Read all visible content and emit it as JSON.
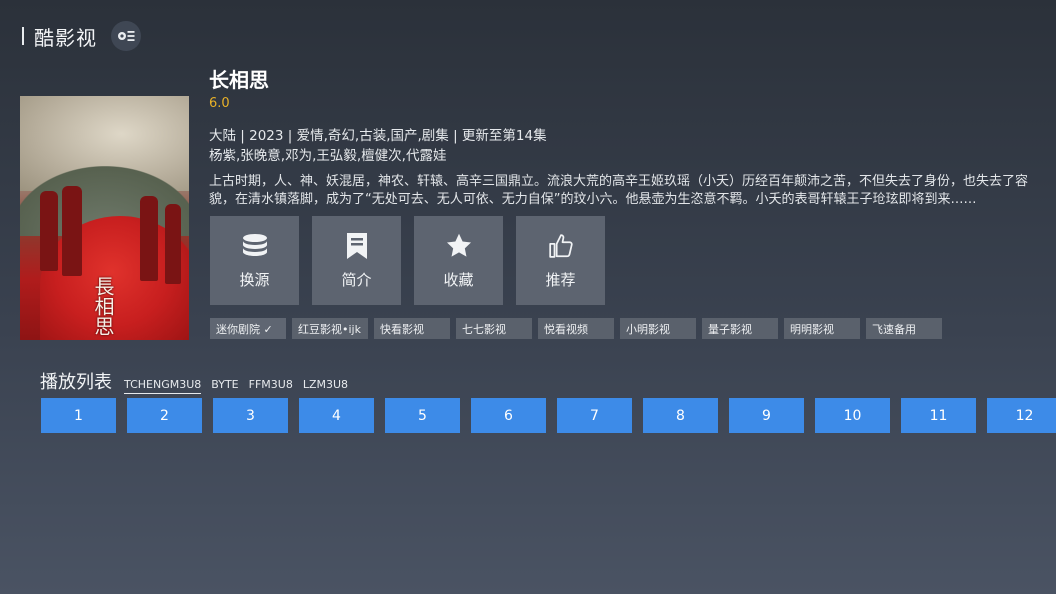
{
  "app": {
    "title": "酷影视",
    "settings_icon": "settings-list-icon"
  },
  "movie": {
    "title": "长相思",
    "rating": "6.0",
    "meta": "大陆 | 2023 | 爱情,奇幻,古装,国产,剧集 | 更新至第14集",
    "cast": "杨紫,张晚意,邓为,王弘毅,檀健次,代露娃",
    "description": "上古时期，人、神、妖混居，神农、轩辕、高辛三国鼎立。流浪大荒的高辛王姬玖瑶（小夭）历经百年颠沛之苦，不但失去了身份，也失去了容貌，在清水镇落脚，成为了“无处可去、无人可依、无力自保”的玟小六。他悬壶为生恣意不羁。小夭的表哥轩辕王子玱玹即将到来……",
    "poster_calligraphy": "長相思"
  },
  "actions": [
    {
      "label": "换源",
      "icon": "database-icon"
    },
    {
      "label": "简介",
      "icon": "bookmark-icon"
    },
    {
      "label": "收藏",
      "icon": "star-icon"
    },
    {
      "label": "推荐",
      "icon": "thumbs-up-icon"
    }
  ],
  "sources": [
    {
      "label": "迷你剧院 ✓",
      "selected": true
    },
    {
      "label": "红豆影视•ijk"
    },
    {
      "label": "快看影视"
    },
    {
      "label": "七七影视"
    },
    {
      "label": "悦看视频"
    },
    {
      "label": "小明影视"
    },
    {
      "label": "量子影视"
    },
    {
      "label": "明明影视"
    },
    {
      "label": "飞速备用"
    }
  ],
  "playlist": {
    "title": "播放列表",
    "tabs": [
      "TCHENGM3U8",
      "BYTE",
      "FFM3U8",
      "LZM3U8"
    ],
    "active_tab": "TCHENGM3U8",
    "episodes": [
      "1",
      "2",
      "3",
      "4",
      "5",
      "6",
      "7",
      "8",
      "9",
      "10",
      "11",
      "12"
    ]
  },
  "colors": {
    "accent": "#3d8be8",
    "rating": "#e8b128",
    "background": "#2b313a"
  }
}
